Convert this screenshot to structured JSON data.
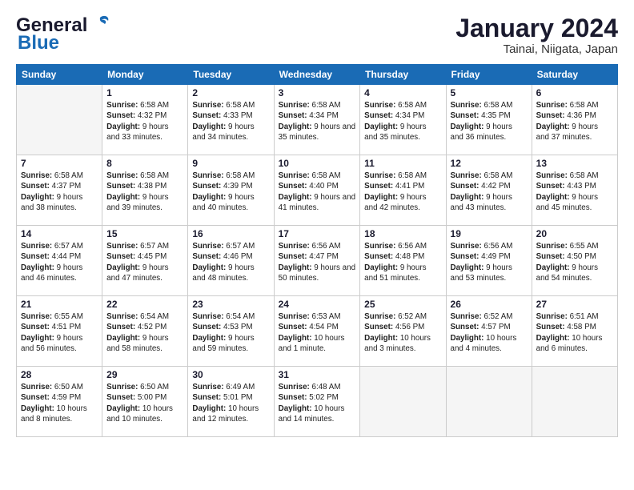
{
  "header": {
    "logo_general": "General",
    "logo_blue": "Blue",
    "title": "January 2024",
    "subtitle": "Tainai, Niigata, Japan"
  },
  "weekdays": [
    "Sunday",
    "Monday",
    "Tuesday",
    "Wednesday",
    "Thursday",
    "Friday",
    "Saturday"
  ],
  "weeks": [
    [
      {
        "day": "",
        "sunrise": "",
        "sunset": "",
        "daylight": ""
      },
      {
        "day": "1",
        "sunrise": "6:58 AM",
        "sunset": "4:32 PM",
        "daylight": "9 hours and 33 minutes."
      },
      {
        "day": "2",
        "sunrise": "6:58 AM",
        "sunset": "4:33 PM",
        "daylight": "9 hours and 34 minutes."
      },
      {
        "day": "3",
        "sunrise": "6:58 AM",
        "sunset": "4:34 PM",
        "daylight": "9 hours and 35 minutes."
      },
      {
        "day": "4",
        "sunrise": "6:58 AM",
        "sunset": "4:34 PM",
        "daylight": "9 hours and 35 minutes."
      },
      {
        "day": "5",
        "sunrise": "6:58 AM",
        "sunset": "4:35 PM",
        "daylight": "9 hours and 36 minutes."
      },
      {
        "day": "6",
        "sunrise": "6:58 AM",
        "sunset": "4:36 PM",
        "daylight": "9 hours and 37 minutes."
      }
    ],
    [
      {
        "day": "7",
        "sunrise": "6:58 AM",
        "sunset": "4:37 PM",
        "daylight": "9 hours and 38 minutes."
      },
      {
        "day": "8",
        "sunrise": "6:58 AM",
        "sunset": "4:38 PM",
        "daylight": "9 hours and 39 minutes."
      },
      {
        "day": "9",
        "sunrise": "6:58 AM",
        "sunset": "4:39 PM",
        "daylight": "9 hours and 40 minutes."
      },
      {
        "day": "10",
        "sunrise": "6:58 AM",
        "sunset": "4:40 PM",
        "daylight": "9 hours and 41 minutes."
      },
      {
        "day": "11",
        "sunrise": "6:58 AM",
        "sunset": "4:41 PM",
        "daylight": "9 hours and 42 minutes."
      },
      {
        "day": "12",
        "sunrise": "6:58 AM",
        "sunset": "4:42 PM",
        "daylight": "9 hours and 43 minutes."
      },
      {
        "day": "13",
        "sunrise": "6:58 AM",
        "sunset": "4:43 PM",
        "daylight": "9 hours and 45 minutes."
      }
    ],
    [
      {
        "day": "14",
        "sunrise": "6:57 AM",
        "sunset": "4:44 PM",
        "daylight": "9 hours and 46 minutes."
      },
      {
        "day": "15",
        "sunrise": "6:57 AM",
        "sunset": "4:45 PM",
        "daylight": "9 hours and 47 minutes."
      },
      {
        "day": "16",
        "sunrise": "6:57 AM",
        "sunset": "4:46 PM",
        "daylight": "9 hours and 48 minutes."
      },
      {
        "day": "17",
        "sunrise": "6:56 AM",
        "sunset": "4:47 PM",
        "daylight": "9 hours and 50 minutes."
      },
      {
        "day": "18",
        "sunrise": "6:56 AM",
        "sunset": "4:48 PM",
        "daylight": "9 hours and 51 minutes."
      },
      {
        "day": "19",
        "sunrise": "6:56 AM",
        "sunset": "4:49 PM",
        "daylight": "9 hours and 53 minutes."
      },
      {
        "day": "20",
        "sunrise": "6:55 AM",
        "sunset": "4:50 PM",
        "daylight": "9 hours and 54 minutes."
      }
    ],
    [
      {
        "day": "21",
        "sunrise": "6:55 AM",
        "sunset": "4:51 PM",
        "daylight": "9 hours and 56 minutes."
      },
      {
        "day": "22",
        "sunrise": "6:54 AM",
        "sunset": "4:52 PM",
        "daylight": "9 hours and 58 minutes."
      },
      {
        "day": "23",
        "sunrise": "6:54 AM",
        "sunset": "4:53 PM",
        "daylight": "9 hours and 59 minutes."
      },
      {
        "day": "24",
        "sunrise": "6:53 AM",
        "sunset": "4:54 PM",
        "daylight": "10 hours and 1 minute."
      },
      {
        "day": "25",
        "sunrise": "6:52 AM",
        "sunset": "4:56 PM",
        "daylight": "10 hours and 3 minutes."
      },
      {
        "day": "26",
        "sunrise": "6:52 AM",
        "sunset": "4:57 PM",
        "daylight": "10 hours and 4 minutes."
      },
      {
        "day": "27",
        "sunrise": "6:51 AM",
        "sunset": "4:58 PM",
        "daylight": "10 hours and 6 minutes."
      }
    ],
    [
      {
        "day": "28",
        "sunrise": "6:50 AM",
        "sunset": "4:59 PM",
        "daylight": "10 hours and 8 minutes."
      },
      {
        "day": "29",
        "sunrise": "6:50 AM",
        "sunset": "5:00 PM",
        "daylight": "10 hours and 10 minutes."
      },
      {
        "day": "30",
        "sunrise": "6:49 AM",
        "sunset": "5:01 PM",
        "daylight": "10 hours and 12 minutes."
      },
      {
        "day": "31",
        "sunrise": "6:48 AM",
        "sunset": "5:02 PM",
        "daylight": "10 hours and 14 minutes."
      },
      {
        "day": "",
        "sunrise": "",
        "sunset": "",
        "daylight": ""
      },
      {
        "day": "",
        "sunrise": "",
        "sunset": "",
        "daylight": ""
      },
      {
        "day": "",
        "sunrise": "",
        "sunset": "",
        "daylight": ""
      }
    ]
  ]
}
